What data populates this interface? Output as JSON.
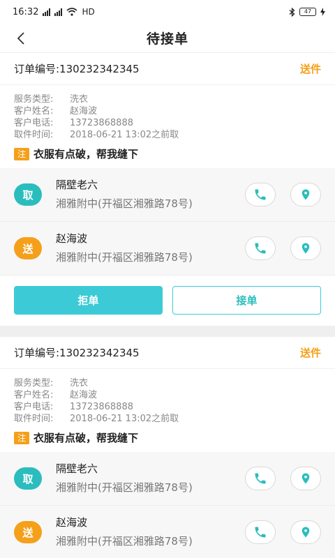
{
  "status_bar": {
    "time": "16:32",
    "network": "HD",
    "battery": "47"
  },
  "nav": {
    "title": "待接单",
    "back_icon": "chevron-left-icon"
  },
  "labels": {
    "service_type": "服务类型:",
    "customer_name": "客户姓名:",
    "customer_phone": "客户电话:",
    "pickup_time": "取件时间:",
    "note_tag": "注",
    "pickup_badge": "取",
    "delivery_badge": "送"
  },
  "colors": {
    "accent_teal": "#2bbdbd",
    "accent_orange": "#f5a01a"
  },
  "orders": [
    {
      "order_no": "订单编号:130232342345",
      "type": "送件",
      "service_type": "洗衣",
      "customer_name": "赵海波",
      "customer_phone": "13723868888",
      "pickup_time": "2018-06-21 13:02之前取",
      "note": "衣服有点破，帮我缝下",
      "pickup": {
        "name": "隔壁老六",
        "address": "湘雅附中(开福区湘雅路78号)"
      },
      "delivery": {
        "name": "赵海波",
        "address": "湘雅附中(开福区湘雅路78号)"
      },
      "reject_label": "拒单",
      "accept_label": "接单"
    },
    {
      "order_no": "订单编号:130232342345",
      "type": "送件",
      "service_type": "洗衣",
      "customer_name": "赵海波",
      "customer_phone": "13723868888",
      "pickup_time": "2018-06-21 13:02之前取",
      "note": "衣服有点破，帮我缝下",
      "pickup": {
        "name": "隔壁老六",
        "address": "湘雅附中(开福区湘雅路78号)"
      },
      "delivery": {
        "name": "赵海波",
        "address": "湘雅附中(开福区湘雅路78号)"
      }
    }
  ]
}
